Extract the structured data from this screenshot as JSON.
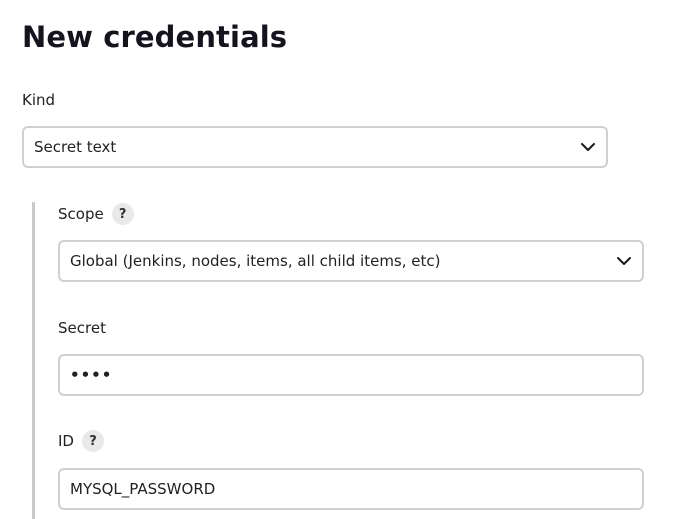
{
  "page": {
    "title": "New credentials"
  },
  "kind": {
    "label": "Kind",
    "selected": "Secret text",
    "icon": "chevron-down-icon"
  },
  "scope": {
    "label": "Scope",
    "help": "?",
    "selected": "Global (Jenkins, nodes, items, all child items, etc)",
    "icon": "chevron-down-icon"
  },
  "secret": {
    "label": "Secret",
    "value": "••••"
  },
  "id": {
    "label": "ID",
    "help": "?",
    "value": "MYSQL_PASSWORD"
  }
}
